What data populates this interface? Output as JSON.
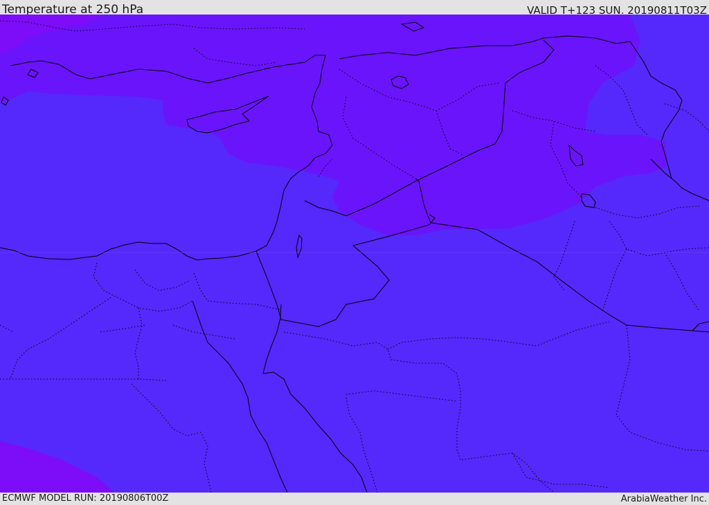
{
  "header": {
    "title": "Temperature at 250 hPa",
    "valid_time": "VALID T+123 SUN. 20190811T03Z"
  },
  "footer": {
    "model_run": "ECMWF MODEL RUN: 20190806T00Z",
    "credit": "ArabiaWeather Inc."
  },
  "map": {
    "colors": {
      "background": "#5528fb",
      "band_warm": "#6a14fb",
      "band_hot": "#7d0cf8",
      "coast_line": "#000000",
      "border_line": "#000000"
    }
  }
}
